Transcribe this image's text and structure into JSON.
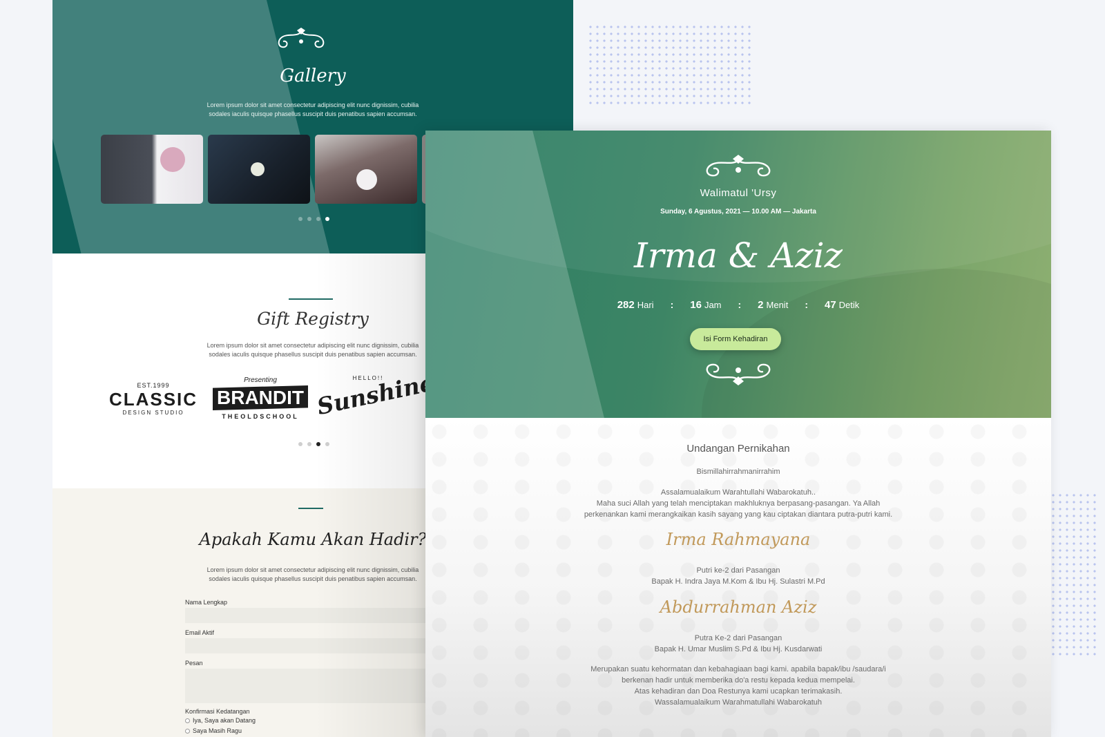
{
  "gallery": {
    "title": "Gallery",
    "description": "Lorem ipsum dolor sit amet consectetur adipiscing elit nunc dignissim, cubilia sodales iaculis quisque phasellus suscipit duis penatibus sapien accumsan."
  },
  "gift": {
    "title": "Gift Registry",
    "description": "Lorem ipsum dolor sit amet consectetur adipiscing elit nunc dignissim, cubilia sodales iaculis quisque phasellus suscipit duis penatibus sapien accumsan.",
    "logos": {
      "classic": {
        "top": "EST.1999",
        "main": "CLASSIC",
        "sub": "DESIGN STUDIO"
      },
      "brandit": {
        "top": "Presenting",
        "main": "BRANDIT",
        "sub": "THEOLDSCHOOL"
      },
      "sunshine": {
        "top": "HELLO!!",
        "main": "Sunshine"
      }
    }
  },
  "rsvp": {
    "title": "Apakah Kamu Akan Hadir?",
    "description": "Lorem ipsum dolor sit amet consectetur adipiscing elit nunc dignissim, cubilia sodales iaculis quisque phasellus suscipit duis penatibus sapien accumsan.",
    "name_label": "Nama Lengkap",
    "email_label": "Email Aktif",
    "message_label": "Pesan",
    "confirm_label": "Konfirmasi Kedatangan",
    "option_yes": "Iya, Saya akan Datang",
    "option_maybe": "Saya Masih Ragu"
  },
  "hero": {
    "event": "Walimatul 'Ursy",
    "date": "Sunday, 6 Agustus, 2021 — 10.00 AM — Jakarta",
    "names": "Irma & Aziz",
    "countdown": {
      "days": "282",
      "days_unit": "Hari",
      "hours": "16",
      "hours_unit": "Jam",
      "minutes": "2",
      "minutes_unit": "Menit",
      "seconds": "47",
      "seconds_unit": "Detik",
      "separator": ":"
    },
    "button": "Isi Form Kehadiran"
  },
  "invitation": {
    "title": "Undangan Pernikahan",
    "bismillah": "Bismillahirrahmanirrahim",
    "greeting": "Assalamualaikum Warahtullahi Wabarokatuh..",
    "paragraph_1": "Maha suci Allah yang telah menciptakan makhluknya berpasang-pasangan. Ya Allah",
    "paragraph_2": "perkenankan kami merangkaikan kasih sayang yang kau ciptakan diantara putra-putri kami.",
    "bride_name": "Irma Rahmayana",
    "bride_role": "Putri ke-2 dari Pasangan",
    "bride_parents": "Bapak H. Indra Jaya M.Kom & Ibu Hj. Sulastri M.Pd",
    "groom_name": "Abdurrahman Aziz",
    "groom_role": "Putra Ke-2 dari Pasangan",
    "groom_parents": "Bapak H. Umar Muslim S.Pd & Ibu Hj. Kusdarwati",
    "closing_1": "Merupakan suatu kehormatan dan kebahagiaan bagi kami. apabila bapak/ibu /saudara/i",
    "closing_2": "berkenan hadir untuk memberika do'a restu kepada kedua mempelai.",
    "closing_3": "Atas kehadiran dan Doa Restunya kami ucapkan terimakasih.",
    "closing_4": "Wassalamualaikum Warahmatullahi Wabarokatuh"
  },
  "colors": {
    "teal": "#0d5e58",
    "green_light": "#8fb072",
    "button": "#c8ea9b",
    "gold": "#c1995a"
  }
}
